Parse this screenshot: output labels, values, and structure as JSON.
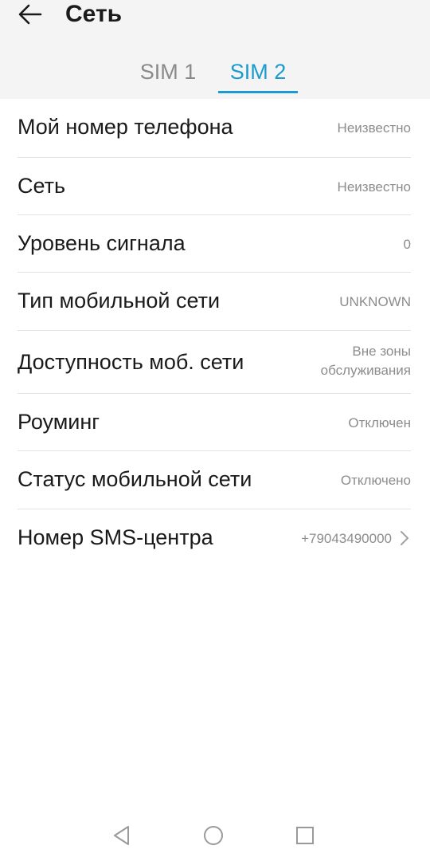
{
  "header": {
    "title": "Сеть",
    "back_icon": "arrow-left-icon"
  },
  "tabs": [
    {
      "label": "SIM 1",
      "active": false
    },
    {
      "label": "SIM 2",
      "active": true
    }
  ],
  "colors": {
    "accent": "#1a9bd0",
    "header_bg": "#f4f4f4",
    "label": "#1a1a1a",
    "value": "#8c8c8c",
    "divider": "#e2e2e2"
  },
  "rows": [
    {
      "label": "Мой номер телефона",
      "value": "Неизвестно"
    },
    {
      "label": "Сеть",
      "value": "Неизвестно"
    },
    {
      "label": "Уровень сигнала",
      "value": "0"
    },
    {
      "label": "Тип мобильной сети",
      "value": "UNKNOWN"
    },
    {
      "label": "Доступность моб. сети",
      "value_line1": "Вне зоны",
      "value_line2": "обслуживания"
    },
    {
      "label": "Роуминг",
      "value": "Отключен"
    },
    {
      "label": "Статус мобильной сети",
      "value": "Отключено"
    },
    {
      "label": "Номер SMS-центра",
      "value": "+79043490000",
      "icon": "chevron-right-icon"
    }
  ],
  "navbar": {
    "icons": [
      "back-triangle-icon",
      "home-circle-icon",
      "recents-square-icon"
    ]
  }
}
